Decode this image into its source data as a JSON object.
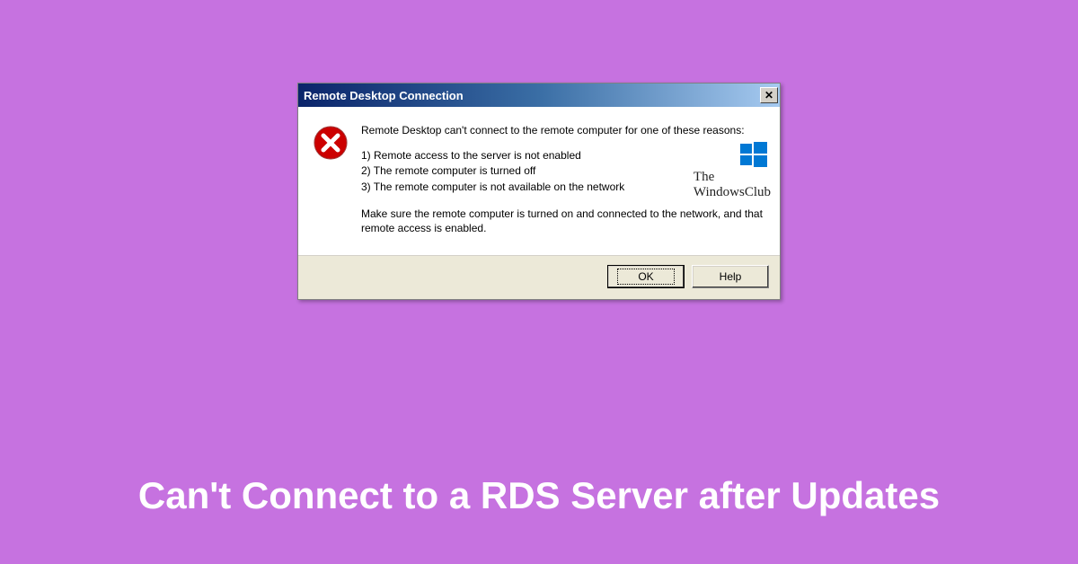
{
  "dialog": {
    "title": "Remote Desktop Connection",
    "close_glyph": "✕",
    "message": {
      "intro": "Remote Desktop can't connect to the remote computer for one of these reasons:",
      "reasons": [
        "1) Remote access to the server is not enabled",
        "2) The remote computer is turned off",
        "3) The remote computer is not available on the network"
      ],
      "advice": "Make sure the remote computer is turned on and connected to the network, and that remote access is enabled."
    },
    "buttons": {
      "ok": "OK",
      "help": "Help"
    }
  },
  "watermark": {
    "line1": "The",
    "line2": "WindowsClub"
  },
  "caption": "Can't Connect to a RDS Server after Updates",
  "colors": {
    "page_bg": "#c672e0",
    "titlebar_start": "#0a246a",
    "titlebar_end": "#a6caf0",
    "dialog_bg": "#ece9d8",
    "error_red": "#cc0000"
  }
}
